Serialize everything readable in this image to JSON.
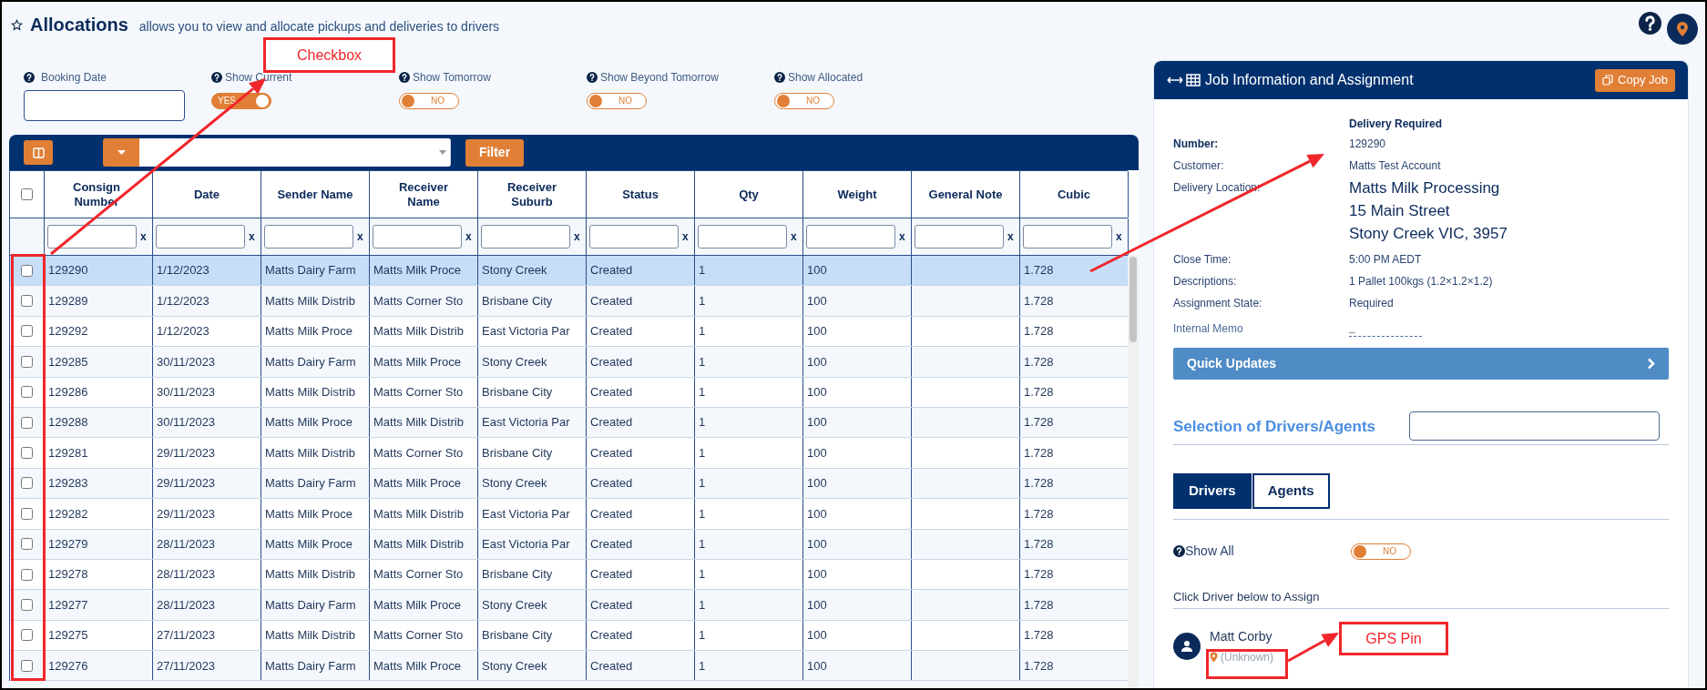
{
  "header": {
    "title": "Allocations",
    "subtitle": "allows you to view and allocate pickups and deliveries to drivers"
  },
  "filters": [
    {
      "kind": "date",
      "label": "Booking Date"
    },
    {
      "kind": "toggle",
      "label": "Show Current",
      "on": true,
      "state_text": "YES"
    },
    {
      "kind": "toggle",
      "label": "Show Tomorrow",
      "on": false,
      "state_text": "NO"
    },
    {
      "kind": "toggle",
      "label": "Show Beyond Tomorrow",
      "on": false,
      "state_text": "NO"
    },
    {
      "kind": "toggle",
      "label": "Show Allocated",
      "on": false,
      "state_text": "NO"
    }
  ],
  "toolbar": {
    "filter_button": "Filter"
  },
  "table": {
    "header_checked": false,
    "column_filters": [
      {
        "clear_label": "x"
      },
      {
        "clear_label": "x"
      },
      {
        "clear_label": "x"
      },
      {
        "clear_label": "x"
      },
      {
        "clear_label": "x"
      },
      {
        "clear_label": "x"
      },
      {
        "clear_label": "x"
      },
      {
        "clear_label": "x"
      },
      {
        "clear_label": "x"
      },
      {
        "clear_label": "x"
      }
    ],
    "columns": [
      "Consign Number",
      "Date",
      "Sender Name",
      "Receiver Name",
      "Receiver Suburb",
      "Status",
      "Qty",
      "Weight",
      "General Note",
      "Cubic"
    ],
    "rows": [
      {
        "checked": false,
        "selected": true,
        "cells": [
          "129290",
          "1/12/2023",
          "Matts Dairy Farm",
          "Matts Milk Proce",
          "Stony Creek",
          "Created",
          "1",
          "100",
          "",
          "1.728"
        ]
      },
      {
        "checked": false,
        "selected": false,
        "cells": [
          "129289",
          "1/12/2023",
          "Matts Milk Distrib",
          "Matts Corner Sto",
          "Brisbane City",
          "Created",
          "1",
          "100",
          "",
          "1.728"
        ]
      },
      {
        "checked": false,
        "selected": false,
        "cells": [
          "129292",
          "1/12/2023",
          "Matts Milk Proce",
          "Matts Milk Distrib",
          "East Victoria Par",
          "Created",
          "1",
          "100",
          "",
          "1.728"
        ]
      },
      {
        "checked": false,
        "selected": false,
        "cells": [
          "129285",
          "30/11/2023",
          "Matts Dairy Farm",
          "Matts Milk Proce",
          "Stony Creek",
          "Created",
          "1",
          "100",
          "",
          "1.728"
        ]
      },
      {
        "checked": false,
        "selected": false,
        "cells": [
          "129286",
          "30/11/2023",
          "Matts Milk Distrib",
          "Matts Corner Sto",
          "Brisbane City",
          "Created",
          "1",
          "100",
          "",
          "1.728"
        ]
      },
      {
        "checked": false,
        "selected": false,
        "cells": [
          "129288",
          "30/11/2023",
          "Matts Milk Proce",
          "Matts Milk Distrib",
          "East Victoria Par",
          "Created",
          "1",
          "100",
          "",
          "1.728"
        ]
      },
      {
        "checked": false,
        "selected": false,
        "cells": [
          "129281",
          "29/11/2023",
          "Matts Milk Distrib",
          "Matts Corner Sto",
          "Brisbane City",
          "Created",
          "1",
          "100",
          "",
          "1.728"
        ]
      },
      {
        "checked": false,
        "selected": false,
        "cells": [
          "129283",
          "29/11/2023",
          "Matts Dairy Farm",
          "Matts Milk Proce",
          "Stony Creek",
          "Created",
          "1",
          "100",
          "",
          "1.728"
        ]
      },
      {
        "checked": false,
        "selected": false,
        "cells": [
          "129282",
          "29/11/2023",
          "Matts Milk Proce",
          "Matts Milk Distrib",
          "East Victoria Par",
          "Created",
          "1",
          "100",
          "",
          "1.728"
        ]
      },
      {
        "checked": false,
        "selected": false,
        "cells": [
          "129279",
          "28/11/2023",
          "Matts Milk Proce",
          "Matts Milk Distrib",
          "East Victoria Par",
          "Created",
          "1",
          "100",
          "",
          "1.728"
        ]
      },
      {
        "checked": false,
        "selected": false,
        "cells": [
          "129278",
          "28/11/2023",
          "Matts Milk Distrib",
          "Matts Corner Sto",
          "Brisbane City",
          "Created",
          "1",
          "100",
          "",
          "1.728"
        ]
      },
      {
        "checked": false,
        "selected": false,
        "cells": [
          "129277",
          "28/11/2023",
          "Matts Dairy Farm",
          "Matts Milk Proce",
          "Stony Creek",
          "Created",
          "1",
          "100",
          "",
          "1.728"
        ]
      },
      {
        "checked": false,
        "selected": false,
        "cells": [
          "129275",
          "27/11/2023",
          "Matts Milk Distrib",
          "Matts Corner Sto",
          "Brisbane City",
          "Created",
          "1",
          "100",
          "",
          "1.728"
        ]
      },
      {
        "checked": false,
        "selected": false,
        "cells": [
          "129276",
          "27/11/2023",
          "Matts Dairy Farm",
          "Matts Milk Proce",
          "Stony Creek",
          "Created",
          "1",
          "100",
          "",
          "1.728"
        ]
      }
    ]
  },
  "job_panel": {
    "title": "Job Information and Assignment",
    "copy_button": "Copy Job",
    "heading": "Delivery Required",
    "fields": [
      {
        "kind": "key",
        "label": "Number:",
        "value": "129290"
      },
      {
        "kind": "plain",
        "label": "Customer:",
        "value": "Matts Test Account"
      },
      {
        "kind": "address",
        "label": "Delivery Location:",
        "lines": [
          "Matts Milk Processing",
          "15 Main Street",
          "Stony Creek VIC, 3957"
        ]
      },
      {
        "kind": "plain",
        "label": "Close Time:",
        "value": "5:00 PM AEDT"
      },
      {
        "kind": "plain",
        "label": "Descriptions:",
        "value": "1 Pallet 100kgs (1.2×1.2×1.2)"
      },
      {
        "kind": "plain",
        "label": "Assignment State:",
        "value": "Required"
      },
      {
        "kind": "memo",
        "label": "Internal Memo",
        "value": "_"
      }
    ],
    "quick_updates": "Quick Updates",
    "selection_title": "Selection of Drivers/Agents",
    "tabs": [
      {
        "label": "Drivers",
        "selected": true
      },
      {
        "label": "Agents",
        "selected": false
      }
    ],
    "show_all": {
      "label": "Show All",
      "on": false,
      "state_text": "NO"
    },
    "instruction": "Click Driver below to Assign",
    "drivers": [
      {
        "name": "Matt Corby",
        "location": "(Unknown)"
      }
    ]
  },
  "annotations": [
    {
      "text": "Checkbox"
    },
    {
      "text": "GPS Pin"
    }
  ]
}
